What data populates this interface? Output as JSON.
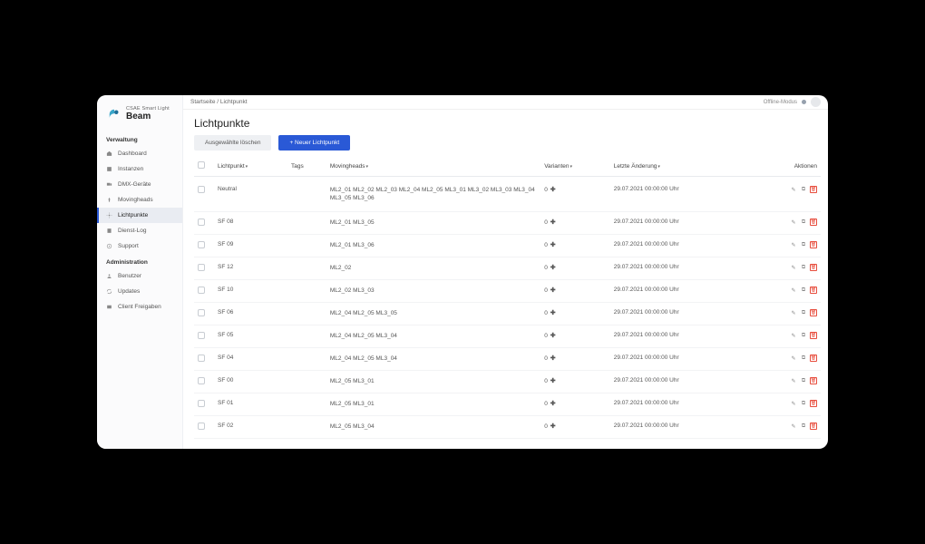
{
  "brand": {
    "line1": "CSAE Smart Light",
    "line2": "Beam"
  },
  "topbar": {
    "breadcrumb": "Startseite  /  Lichtpunkt",
    "offline_label": "Offline-Modus"
  },
  "sidebar": {
    "section1_title": "Verwaltung",
    "items1": [
      {
        "label": "Dashboard"
      },
      {
        "label": "Instanzen"
      },
      {
        "label": "DMX-Geräte"
      },
      {
        "label": "Movingheads"
      },
      {
        "label": "Lichtpunkte",
        "active": true
      },
      {
        "label": "Dienst-Log"
      },
      {
        "label": "Support"
      }
    ],
    "section2_title": "Administration",
    "items2": [
      {
        "label": "Benutzer"
      },
      {
        "label": "Updates"
      },
      {
        "label": "Client Freigaben"
      }
    ]
  },
  "page": {
    "title": "Lichtpunkte"
  },
  "buttons": {
    "delete_selected": "Ausgewählte löschen",
    "new": "+ Neuer Lichtpunkt"
  },
  "columns": {
    "lichtpunkt": "Lichtpunkt",
    "tags": "Tags",
    "movingheads": "Movingheads",
    "varianten": "Varianten",
    "letzte": "Letzte Änderung",
    "aktionen": "Aktionen"
  },
  "rows": [
    {
      "name": "Neutral",
      "mh": "ML2_01 ML2_02 ML2_03 ML2_04 ML2_05 ML3_01 ML3_02 ML3_03 ML3_04 ML3_05 ML3_06",
      "var": "0",
      "date": "29.07.2021 00:00:00 Uhr"
    },
    {
      "name": "SF 08",
      "mh": "ML2_01 ML3_05",
      "var": "0",
      "date": "29.07.2021 00:00:00 Uhr"
    },
    {
      "name": "SF 09",
      "mh": "ML2_01 ML3_06",
      "var": "0",
      "date": "29.07.2021 00:00:00 Uhr"
    },
    {
      "name": "SF 12",
      "mh": "ML2_02",
      "var": "0",
      "date": "29.07.2021 00:00:00 Uhr"
    },
    {
      "name": "SF 10",
      "mh": "ML2_02 ML3_03",
      "var": "0",
      "date": "29.07.2021 00:00:00 Uhr"
    },
    {
      "name": "SF 06",
      "mh": "ML2_04 ML2_05 ML3_05",
      "var": "0",
      "date": "29.07.2021 00:00:00 Uhr"
    },
    {
      "name": "SF 05",
      "mh": "ML2_04 ML2_05 ML3_04",
      "var": "0",
      "date": "29.07.2021 00:00:00 Uhr"
    },
    {
      "name": "SF 04",
      "mh": "ML2_04 ML2_05 ML3_04",
      "var": "0",
      "date": "29.07.2021 00:00:00 Uhr"
    },
    {
      "name": "SF 00",
      "mh": "ML2_05 ML3_01",
      "var": "0",
      "date": "29.07.2021 00:00:00 Uhr"
    },
    {
      "name": "SF 01",
      "mh": "ML2_05 ML3_01",
      "var": "0",
      "date": "29.07.2021 00:00:00 Uhr"
    },
    {
      "name": "SF 02",
      "mh": "ML2_05 ML3_04",
      "var": "0",
      "date": "29.07.2021 00:00:00 Uhr"
    }
  ]
}
